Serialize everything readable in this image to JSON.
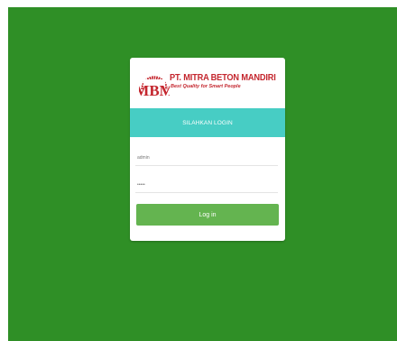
{
  "brand": {
    "name": "PT. MITRA BETON MANDIRI",
    "tagline": "Best Quality for Smart People",
    "logo_icon": "mbm-logo-icon",
    "logo_text": "MBM",
    "logo_ring_text": "MITRA BETON"
  },
  "login": {
    "heading": "SILAHKAN LOGIN",
    "username_value": "admin",
    "password_value": "•••••",
    "submit_label": "Log in"
  },
  "colors": {
    "background": "#2f8f26",
    "banner": "#47cdc4",
    "button": "#64b450",
    "brand_red": "#c4262e"
  }
}
